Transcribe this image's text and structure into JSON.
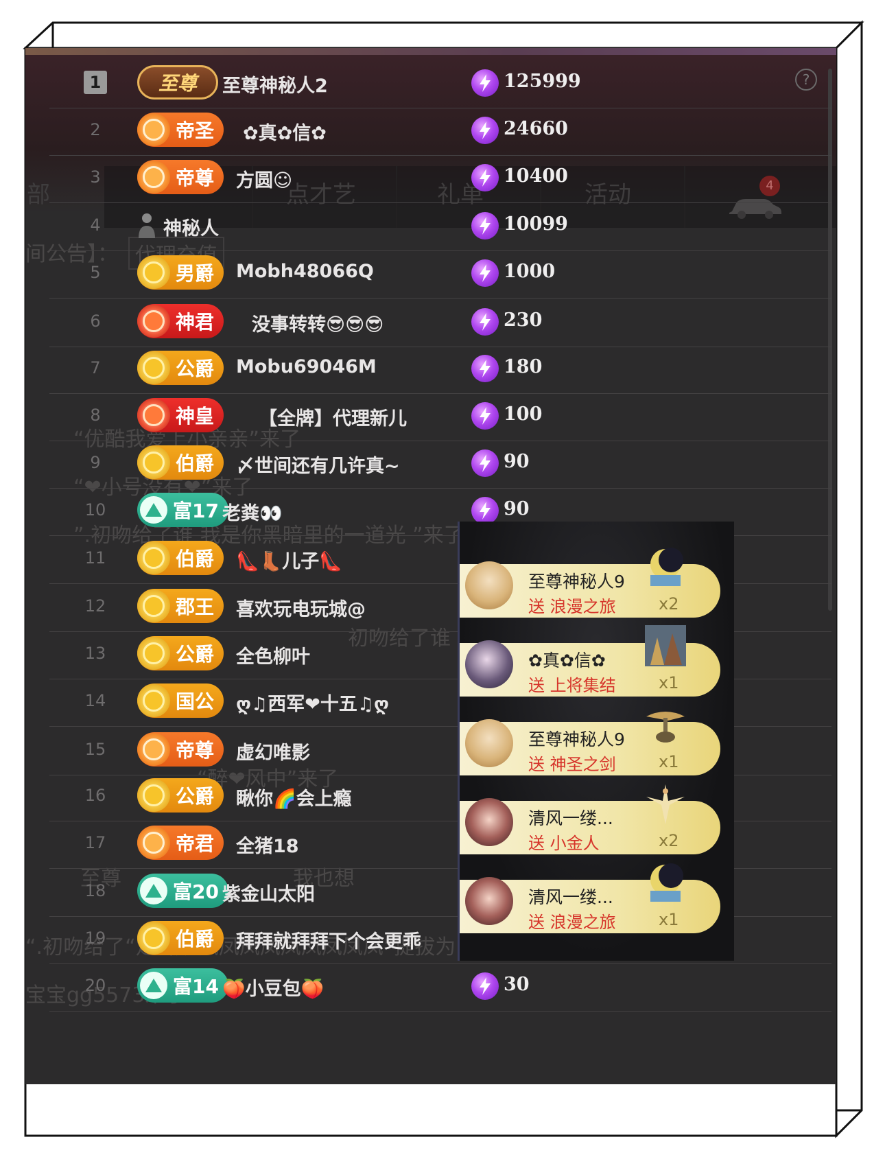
{
  "help_icon": "?",
  "car_badge": "4",
  "background_tabs": [
    "部",
    "点才艺",
    "礼单",
    "活动"
  ],
  "background_ghost_text": [
    "间公告】：",
    "代理充值",
    "“优酷我爱上小亲亲”来了",
    "“❤小号没有❤”来了",
    "”.初吻给了谁 我是你黑暗里的一道光 ”来了",
    "初吻给了谁",
    "“醉❤风中”来了",
    "至尊",
    "我也想",
    "“.初吻给了“定”被“凤凤凤凤凤凤凤凤凤”提拔为",
    "宝宝gg5573来了"
  ],
  "ranking": [
    {
      "rank": "1",
      "badge": "至尊",
      "badge_style": "supreme",
      "name": "至尊神秘人2",
      "score": "125999"
    },
    {
      "rank": "2",
      "badge": "帝圣",
      "badge_style": "orange",
      "name": "✿真✿信✿",
      "score": "24660"
    },
    {
      "rank": "3",
      "badge": "帝尊",
      "badge_style": "orange",
      "name": "方圆☺",
      "score": "10400"
    },
    {
      "rank": "4",
      "badge": "",
      "badge_style": "none",
      "name": "神秘人",
      "score": "10099"
    },
    {
      "rank": "5",
      "badge": "男爵",
      "badge_style": "gold",
      "name": "Mobh48066Q",
      "score": "1000"
    },
    {
      "rank": "6",
      "badge": "神君",
      "badge_style": "red",
      "name": "没事转转😎😎😎",
      "score": "230"
    },
    {
      "rank": "7",
      "badge": "公爵",
      "badge_style": "gold",
      "name": "Mobu69046M",
      "score": "180"
    },
    {
      "rank": "8",
      "badge": "神皇",
      "badge_style": "red",
      "name": "【全牌】代理新儿",
      "score": "100"
    },
    {
      "rank": "9",
      "badge": "伯爵",
      "badge_style": "gold",
      "name": "〆世间还有几许真~",
      "score": "90"
    },
    {
      "rank": "10",
      "badge": "富17",
      "badge_style": "teal",
      "name": "老粪👀",
      "score": "90"
    },
    {
      "rank": "11",
      "badge": "伯爵",
      "badge_style": "gold",
      "name": "👠👢儿子👠",
      "score": ""
    },
    {
      "rank": "12",
      "badge": "郡王",
      "badge_style": "gold",
      "name": "喜欢玩电玩城@",
      "score": ""
    },
    {
      "rank": "13",
      "badge": "公爵",
      "badge_style": "gold",
      "name": "全色柳叶",
      "score": ""
    },
    {
      "rank": "14",
      "badge": "国公",
      "badge_style": "gold",
      "name": "ღ♫西军❤十五♫ღ",
      "score": ""
    },
    {
      "rank": "15",
      "badge": "帝尊",
      "badge_style": "orange",
      "name": "虚幻唯影",
      "score": ""
    },
    {
      "rank": "16",
      "badge": "公爵",
      "badge_style": "gold",
      "name": "瞅你🌈会上瘾",
      "score": ""
    },
    {
      "rank": "17",
      "badge": "帝君",
      "badge_style": "orange",
      "name": "全猪18",
      "score": ""
    },
    {
      "rank": "18",
      "badge": "富20",
      "badge_style": "teal",
      "name": "紫金山太阳",
      "score": ""
    },
    {
      "rank": "19",
      "badge": "伯爵",
      "badge_style": "gold",
      "name": "拜拜就拜拜下个会更乖",
      "score": ""
    },
    {
      "rank": "20",
      "badge": "富14",
      "badge_style": "teal",
      "name": "🍑小豆包🍑",
      "score": "30"
    }
  ],
  "gifts": [
    {
      "sender": "至尊神秘人9",
      "action": "送 浪漫之旅",
      "count": "x2",
      "avatar": "mask",
      "gift_icon": "moon-icon"
    },
    {
      "sender": "✿真✿信✿",
      "action": "送 上将集结",
      "count": "x1",
      "avatar": "anime",
      "gift_icon": "warriors-icon"
    },
    {
      "sender": "至尊神秘人9",
      "action": "送 神圣之剑",
      "count": "x1",
      "avatar": "mask",
      "gift_icon": "sword-icon"
    },
    {
      "sender": "清风一缕...",
      "action": "送 小金人",
      "count": "x2",
      "avatar": "girl",
      "gift_icon": "angel-icon"
    },
    {
      "sender": "清风一缕...",
      "action": "送 浪漫之旅",
      "count": "x1",
      "avatar": "girl",
      "gift_icon": "moon-icon"
    }
  ]
}
